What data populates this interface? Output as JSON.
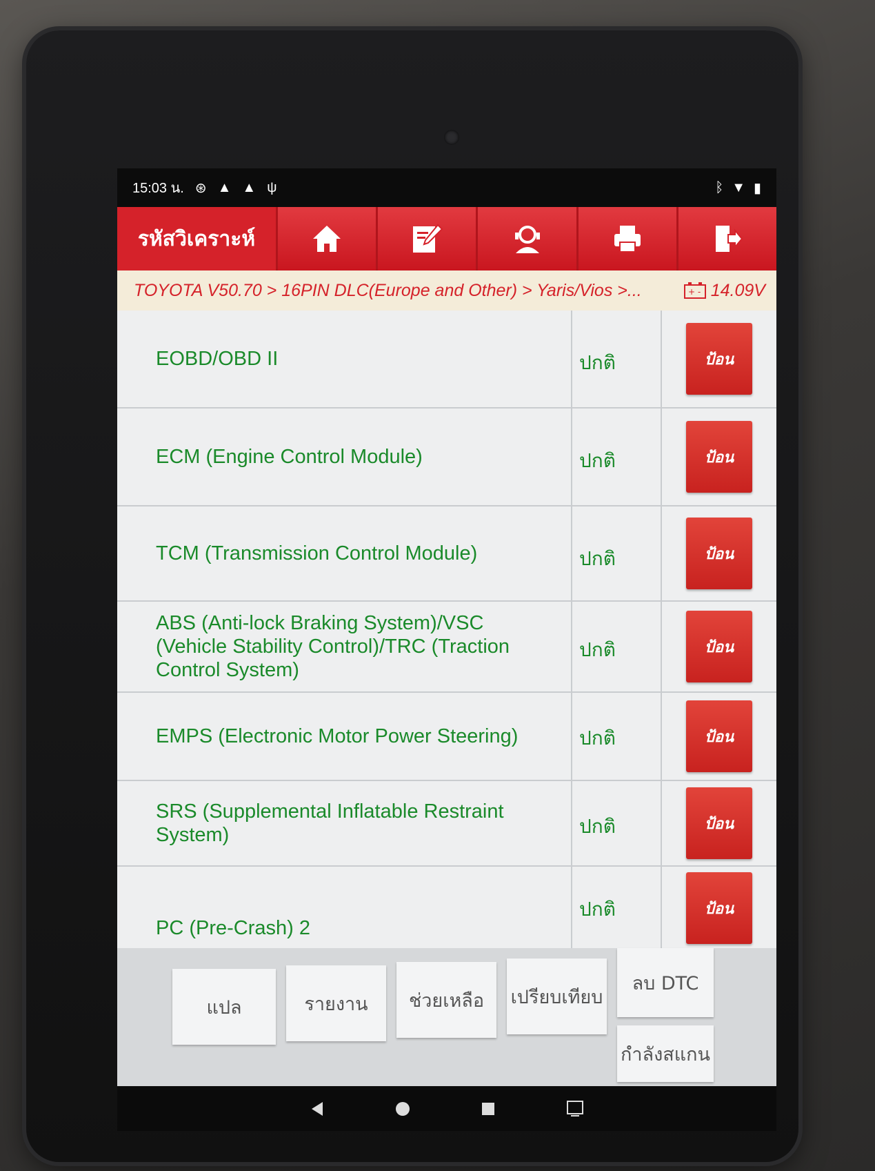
{
  "status_bar": {
    "time": "15:03 น."
  },
  "toolbar": {
    "title": "รหัสวิเคราะห์",
    "accent": "#d5222a"
  },
  "breadcrumb": {
    "path": "TOYOTA V50.70 > 16PIN DLC(Europe and Other) > Yaris/Vios >...",
    "voltage": "14.09V"
  },
  "modules": [
    {
      "name": "EOBD/OBD II",
      "status": "ปกติ",
      "action": "ป้อน"
    },
    {
      "name": "ECM (Engine Control Module)",
      "status": "ปกติ",
      "action": "ป้อน"
    },
    {
      "name": "TCM (Transmission Control Module)",
      "status": "ปกติ",
      "action": "ป้อน"
    },
    {
      "name": "ABS (Anti-lock Braking System)/VSC (Vehicle Stability Control)/TRC (Traction Control System)",
      "status": "ปกติ",
      "action": "ป้อน"
    },
    {
      "name": "EMPS (Electronic Motor Power Steering)",
      "status": "ปกติ",
      "action": "ป้อน"
    },
    {
      "name": "SRS (Supplemental Inflatable Restraint System)",
      "status": "ปกติ",
      "action": "ป้อน"
    },
    {
      "name": "PC (Pre-Crash) 2",
      "status": "ปกติ",
      "action": "ป้อน"
    }
  ],
  "bottom_buttons": {
    "translate": "แปล",
    "report": "รายงาน",
    "help": "ช่วยเหลือ",
    "compare": "เปรียบเทียบ",
    "clear_dtc": "ลบ DTC",
    "scanning": "กำลังสแกน"
  }
}
